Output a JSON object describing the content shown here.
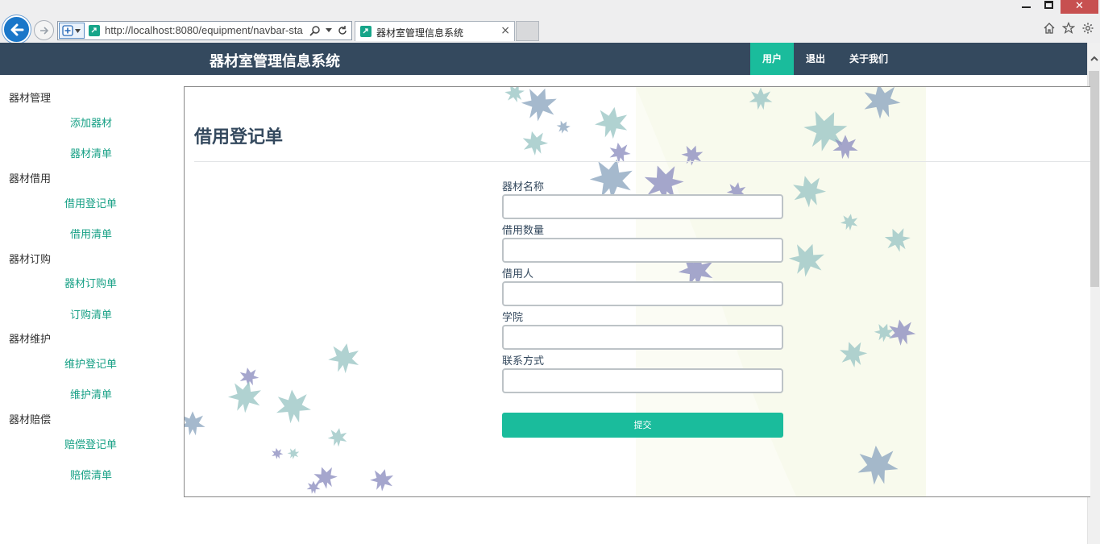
{
  "browser": {
    "url": "http://localhost:8080/equipment/navbar-sta",
    "tab_title": "器材室管理信息系统",
    "tab_close": "×",
    "window_close": "✕"
  },
  "app": {
    "brand": "器材室管理信息系统",
    "nav": [
      {
        "label": "用户",
        "active": true
      },
      {
        "label": "退出",
        "active": false
      },
      {
        "label": "关于我们",
        "active": false
      }
    ]
  },
  "sidebar": {
    "groups": [
      {
        "title": "器材管理",
        "links": [
          "添加器材",
          "器材清单"
        ]
      },
      {
        "title": "器材借用",
        "links": [
          "借用登记单",
          "借用清单"
        ]
      },
      {
        "title": "器材订购",
        "links": [
          "器材订购单",
          "订购清单"
        ]
      },
      {
        "title": "器材维护",
        "links": [
          "维护登记单",
          "维护清单"
        ]
      },
      {
        "title": "器材赔偿",
        "links": [
          "赔偿登记单",
          "赔偿清单"
        ]
      }
    ]
  },
  "main": {
    "title": "借用登记单",
    "fields": [
      {
        "label": "器材名称",
        "value": ""
      },
      {
        "label": "借用数量",
        "value": ""
      },
      {
        "label": "借用人",
        "value": ""
      },
      {
        "label": "学院",
        "value": ""
      },
      {
        "label": "联系方式",
        "value": ""
      }
    ],
    "submit_label": "提交"
  },
  "colors": {
    "navbar": "#34495e",
    "accent": "#1abc9c",
    "link": "#16a085"
  }
}
